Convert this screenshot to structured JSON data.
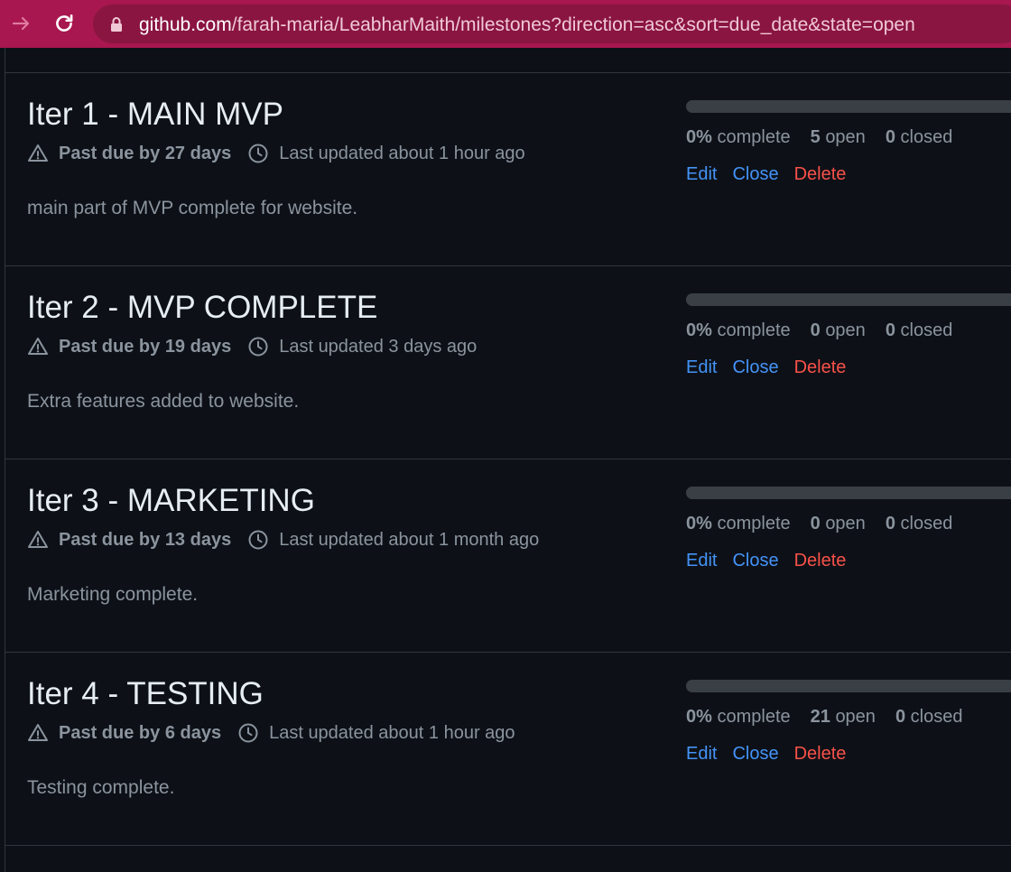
{
  "browser": {
    "url_host": "github.com",
    "url_path": "/farah-maria/LeabharMaith/milestones?direction=asc&sort=due_date&state=open"
  },
  "icons": {
    "forward": "forward-arrow-icon",
    "reload": "reload-icon",
    "lock": "lock-icon",
    "alert": "alert-triangle-icon",
    "clock": "clock-icon"
  },
  "colors": {
    "browser_bar": "#a8174f",
    "page_bg": "#0d1117",
    "link": "#4493f8",
    "danger": "#f85149",
    "muted": "#8b949e"
  },
  "milestones": [
    {
      "title": "Iter 1 - MAIN MVP",
      "past_due": "Past due by 27 days",
      "updated": "Last updated about 1 hour ago",
      "description": "main part of MVP complete for website.",
      "progress": 0,
      "percent": "0%",
      "percent_label": "complete",
      "open_count": "5",
      "open_label": "open",
      "closed_count": "0",
      "closed_label": "closed",
      "edit": "Edit",
      "close": "Close",
      "delete": "Delete"
    },
    {
      "title": "Iter 2 - MVP COMPLETE",
      "past_due": "Past due by 19 days",
      "updated": "Last updated 3 days ago",
      "description": "Extra features added to website.",
      "progress": 0,
      "percent": "0%",
      "percent_label": "complete",
      "open_count": "0",
      "open_label": "open",
      "closed_count": "0",
      "closed_label": "closed",
      "edit": "Edit",
      "close": "Close",
      "delete": "Delete"
    },
    {
      "title": "Iter 3 - MARKETING",
      "past_due": "Past due by 13 days",
      "updated": "Last updated about 1 month ago",
      "description": "Marketing complete.",
      "progress": 0,
      "percent": "0%",
      "percent_label": "complete",
      "open_count": "0",
      "open_label": "open",
      "closed_count": "0",
      "closed_label": "closed",
      "edit": "Edit",
      "close": "Close",
      "delete": "Delete"
    },
    {
      "title": "Iter 4 - TESTING",
      "past_due": "Past due by 6 days",
      "updated": "Last updated about 1 hour ago",
      "description": "Testing complete.",
      "progress": 0,
      "percent": "0%",
      "percent_label": "complete",
      "open_count": "21",
      "open_label": "open",
      "closed_count": "0",
      "closed_label": "closed",
      "edit": "Edit",
      "close": "Close",
      "delete": "Delete"
    }
  ]
}
